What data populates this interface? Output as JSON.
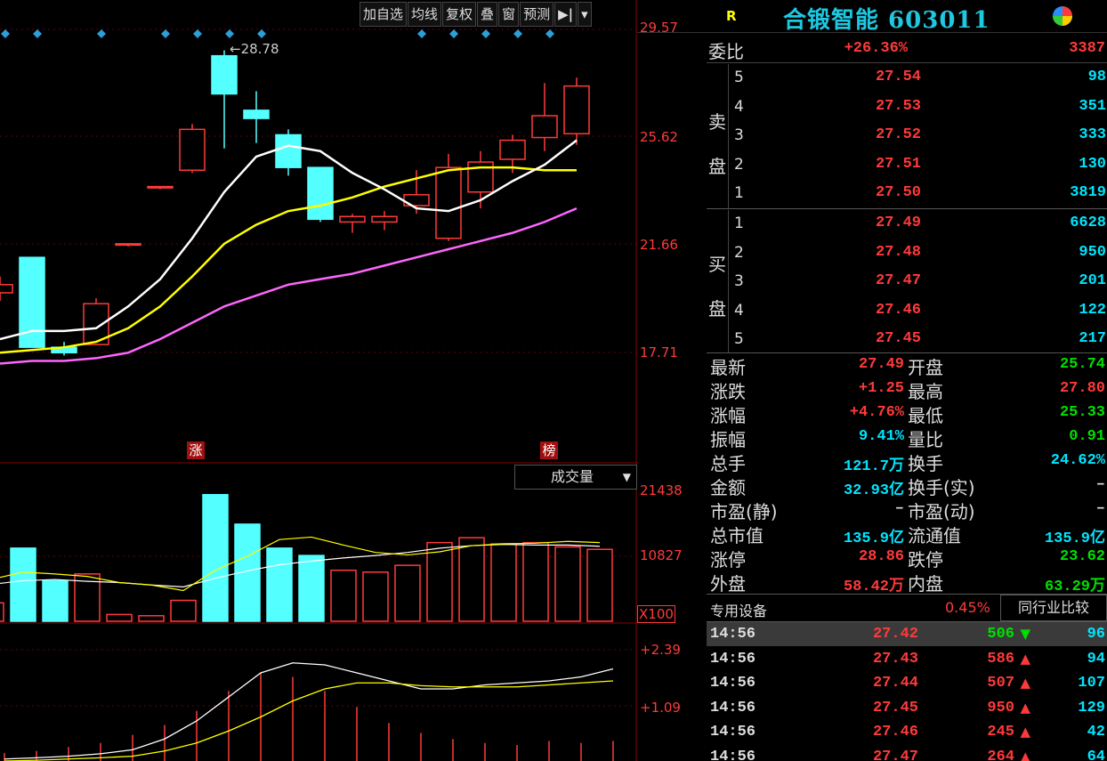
{
  "toolbar": {
    "buttons": [
      "加自选",
      "均线",
      "复权",
      "叠",
      "窗",
      "预测"
    ],
    "next_icon": "▶|",
    "menu_icon": "▾"
  },
  "price_axis": [
    "29.57",
    "25.62",
    "21.66",
    "17.71"
  ],
  "high_label": "28.78",
  "badges": {
    "zhang": "涨",
    "bang": "榜"
  },
  "volume_panel": {
    "selector": "成交量",
    "axis": [
      "21438",
      "10827"
    ],
    "unit": "X100"
  },
  "macd_panel": {
    "axis": [
      "+2.39",
      "+1.09"
    ]
  },
  "chart_data": {
    "type": "candlestick",
    "price_range": [
      15.6,
      30.0
    ],
    "candles": [
      {
        "open": 20.2,
        "high": 20.5,
        "low": 19.6,
        "close": 19.9,
        "dir": "up"
      },
      {
        "open": 21.2,
        "high": 21.2,
        "low": 17.9,
        "close": 17.9,
        "dir": "down"
      },
      {
        "open": 17.9,
        "high": 18.1,
        "low": 17.6,
        "close": 17.7,
        "dir": "down"
      },
      {
        "open": 18.0,
        "high": 19.7,
        "low": 18.0,
        "close": 19.5,
        "dir": "up"
      },
      {
        "open": 21.7,
        "high": 21.7,
        "low": 21.6,
        "close": 21.7,
        "dir": "up"
      },
      {
        "open": 23.8,
        "high": 23.8,
        "low": 23.7,
        "close": 23.8,
        "dir": "up"
      },
      {
        "open": 24.4,
        "high": 26.1,
        "low": 24.3,
        "close": 25.9,
        "dir": "up"
      },
      {
        "open": 28.6,
        "high": 28.8,
        "low": 25.2,
        "close": 27.2,
        "dir": "down"
      },
      {
        "open": 26.6,
        "high": 27.3,
        "low": 25.4,
        "close": 26.3,
        "dir": "down"
      },
      {
        "open": 25.7,
        "high": 25.9,
        "low": 24.2,
        "close": 24.5,
        "dir": "down"
      },
      {
        "open": 24.5,
        "high": 24.5,
        "low": 22.5,
        "close": 22.6,
        "dir": "down"
      },
      {
        "open": 22.5,
        "high": 22.8,
        "low": 22.1,
        "close": 22.7,
        "dir": "up"
      },
      {
        "open": 22.5,
        "high": 22.9,
        "low": 22.2,
        "close": 22.7,
        "dir": "up"
      },
      {
        "open": 23.1,
        "high": 24.4,
        "low": 22.8,
        "close": 23.5,
        "dir": "up"
      },
      {
        "open": 21.9,
        "high": 25.0,
        "low": 21.8,
        "close": 24.5,
        "dir": "up"
      },
      {
        "open": 23.6,
        "high": 25.1,
        "low": 23.0,
        "close": 24.7,
        "dir": "up"
      },
      {
        "open": 24.8,
        "high": 25.7,
        "low": 24.3,
        "close": 25.5,
        "dir": "up"
      },
      {
        "open": 25.6,
        "high": 27.6,
        "low": 25.1,
        "close": 26.4,
        "dir": "up"
      },
      {
        "open": 25.74,
        "high": 27.8,
        "low": 25.33,
        "close": 27.49,
        "dir": "up"
      }
    ],
    "ma_white": [
      18.2,
      18.5,
      18.5,
      18.6,
      19.4,
      20.4,
      21.9,
      23.6,
      24.9,
      25.3,
      25.1,
      24.3,
      23.7,
      23.0,
      22.9,
      23.3,
      24.0,
      24.6,
      25.5
    ],
    "ma_yellow": [
      17.7,
      17.8,
      17.9,
      18.1,
      18.6,
      19.4,
      20.5,
      21.7,
      22.4,
      22.9,
      23.1,
      23.4,
      23.8,
      24.1,
      24.4,
      24.5,
      24.5,
      24.4,
      24.4
    ],
    "ma_pink": [
      17.3,
      17.4,
      17.4,
      17.5,
      17.7,
      18.2,
      18.8,
      19.4,
      19.8,
      20.2,
      20.4,
      20.6,
      20.9,
      21.2,
      21.5,
      21.8,
      22.1,
      22.5,
      23.0
    ],
    "volume": [
      3000,
      11900,
      6600,
      7700,
      1100,
      900,
      3400,
      20600,
      15800,
      11900,
      10700,
      8300,
      8000,
      9100,
      12800,
      13600,
      12600,
      12800,
      12100,
      11700
    ],
    "volume_dir": [
      "up",
      "down",
      "down",
      "up",
      "up",
      "up",
      "up",
      "down",
      "down",
      "down",
      "down",
      "up",
      "up",
      "up",
      "up",
      "up",
      "up",
      "up",
      "up",
      "up"
    ],
    "volume_ma_yellow": [
      6800,
      8000,
      7700,
      7300,
      6300,
      5900,
      5000,
      8300,
      10600,
      13300,
      13700,
      12400,
      11200,
      10800,
      11300,
      12300,
      12600,
      12700,
      13000,
      12800
    ],
    "volume_ma_white": [
      6000,
      6600,
      6800,
      6500,
      6300,
      5900,
      5600,
      7000,
      8200,
      9200,
      9800,
      10300,
      10700,
      11200,
      11900,
      12300,
      12500,
      12400,
      12400,
      12200
    ],
    "macd_white": [
      0.05,
      0.08,
      0.12,
      0.18,
      0.28,
      0.55,
      1.0,
      1.6,
      2.2,
      2.45,
      2.4,
      2.2,
      2.0,
      1.8,
      1.8,
      1.9,
      1.95,
      2.0,
      2.1,
      2.3
    ],
    "macd_yellow": [
      0.0,
      0.02,
      0.05,
      0.08,
      0.12,
      0.25,
      0.45,
      0.75,
      1.1,
      1.5,
      1.8,
      1.95,
      1.95,
      1.88,
      1.85,
      1.85,
      1.85,
      1.9,
      1.95,
      2.0
    ],
    "macd_bars": [
      0.2,
      0.25,
      0.35,
      0.45,
      0.65,
      0.9,
      1.25,
      1.75,
      2.2,
      2.1,
      1.75,
      1.35,
      0.95,
      0.7,
      0.55,
      0.45,
      0.4,
      0.5,
      0.45,
      0.5
    ],
    "markers": [
      true,
      true,
      false,
      true,
      false,
      true,
      true,
      true,
      true,
      false,
      false,
      false,
      false,
      true,
      true,
      true,
      true,
      true,
      false,
      false
    ],
    "macd_range": [
      0.0,
      3.0
    ]
  },
  "quote": {
    "code": "R",
    "title": "合锻智能 603011",
    "weibi": {
      "label": "委比",
      "pct": "+26.36%",
      "diff": "3387"
    },
    "sell_label": [
      "卖",
      "盘"
    ],
    "buy_label": [
      "买",
      "盘"
    ],
    "sell": [
      {
        "lv": "5",
        "price": "27.54",
        "vol": "98"
      },
      {
        "lv": "4",
        "price": "27.53",
        "vol": "351"
      },
      {
        "lv": "3",
        "price": "27.52",
        "vol": "333"
      },
      {
        "lv": "2",
        "price": "27.51",
        "vol": "130"
      },
      {
        "lv": "1",
        "price": "27.50",
        "vol": "3819"
      }
    ],
    "buy": [
      {
        "lv": "1",
        "price": "27.49",
        "vol": "6628"
      },
      {
        "lv": "2",
        "price": "27.48",
        "vol": "950"
      },
      {
        "lv": "3",
        "price": "27.47",
        "vol": "201"
      },
      {
        "lv": "4",
        "price": "27.46",
        "vol": "122"
      },
      {
        "lv": "5",
        "price": "27.45",
        "vol": "217"
      }
    ],
    "stats": [
      {
        "l1": "最新",
        "v1": "27.49",
        "c1": "red",
        "l2": "开盘",
        "v2": "25.74",
        "c2": "green"
      },
      {
        "l1": "涨跌",
        "v1": "+1.25",
        "c1": "red",
        "l2": "最高",
        "v2": "27.80",
        "c2": "red"
      },
      {
        "l1": "涨幅",
        "v1": "+4.76%",
        "c1": "red",
        "l2": "最低",
        "v2": "25.33",
        "c2": "green"
      },
      {
        "l1": "振幅",
        "v1": "9.41%",
        "c1": "cyan",
        "l2": "量比",
        "v2": "0.91",
        "c2": "green"
      },
      {
        "l1": "总手",
        "v1": "121.7万",
        "c1": "cyan",
        "l2": "换手",
        "v2": "24.62%",
        "c2": "cyan"
      },
      {
        "l1": "金额",
        "v1": "32.93亿",
        "c1": "cyan",
        "l2": "换手(实)",
        "v2": "–",
        "c2": "white"
      },
      {
        "l1": "市盈(静)",
        "v1": "–",
        "c1": "white",
        "l2": "市盈(动)",
        "v2": "–",
        "c2": "white"
      },
      {
        "l1": "总市值",
        "v1": "135.9亿",
        "c1": "cyan",
        "l2": "流通值",
        "v2": "135.9亿",
        "c2": "cyan"
      },
      {
        "l1": "涨停",
        "v1": "28.86",
        "c1": "red",
        "l2": "跌停",
        "v2": "23.62",
        "c2": "green"
      },
      {
        "l1": "外盘",
        "v1": "58.42万",
        "c1": "red",
        "l2": "内盘",
        "v2": "63.29万",
        "c2": "green"
      }
    ],
    "industry": {
      "name": "专用设备",
      "pct": "0.45%",
      "compare": "同行业比较"
    },
    "ticks": [
      {
        "time": "14:56",
        "price": "27.42",
        "vol": "506",
        "dir": "down",
        "num": "96"
      },
      {
        "time": "14:56",
        "price": "27.43",
        "vol": "586",
        "dir": "up",
        "num": "94"
      },
      {
        "time": "14:56",
        "price": "27.44",
        "vol": "507",
        "dir": "up",
        "num": "107"
      },
      {
        "time": "14:56",
        "price": "27.45",
        "vol": "950",
        "dir": "up",
        "num": "129"
      },
      {
        "time": "14:56",
        "price": "27.46",
        "vol": "245",
        "dir": "up",
        "num": "42"
      },
      {
        "time": "14:56",
        "price": "27.47",
        "vol": "264",
        "dir": "up",
        "num": "64"
      }
    ]
  },
  "colors": {
    "up": "#ff3a3a",
    "down": "#54ffff",
    "ma_white": "#ffffff",
    "ma_yellow": "#ffff00",
    "ma_pink": "#ff66ff",
    "marker": "#2aa0d8"
  }
}
